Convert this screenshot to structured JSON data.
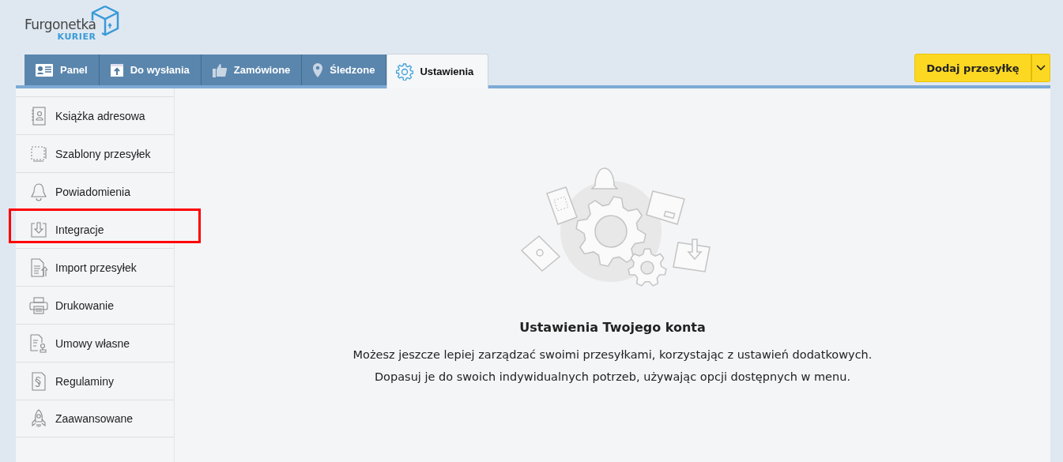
{
  "logo": {
    "name": "Furgonetka",
    "sub": "KURIER"
  },
  "tabs": [
    {
      "label": "Panel",
      "selected": false
    },
    {
      "label": "Do wysłania",
      "selected": false
    },
    {
      "label": "Zamówione",
      "selected": false
    },
    {
      "label": "Śledzone",
      "selected": false
    },
    {
      "label": "Ustawienia",
      "selected": true
    }
  ],
  "add_button": {
    "label": "Dodaj przesyłkę"
  },
  "sidebar": {
    "items": [
      {
        "label": "Książka adresowa",
        "highlighted": false
      },
      {
        "label": "Szablony przesyłek",
        "highlighted": false
      },
      {
        "label": "Powiadomienia",
        "highlighted": false
      },
      {
        "label": "Integracje",
        "highlighted": true
      },
      {
        "label": "Import przesyłek",
        "highlighted": false
      },
      {
        "label": "Drukowanie",
        "highlighted": false
      },
      {
        "label": "Umowy własne",
        "highlighted": false
      },
      {
        "label": "Regulaminy",
        "highlighted": false
      },
      {
        "label": "Zaawansowane",
        "highlighted": false
      }
    ]
  },
  "content": {
    "title": "Ustawienia Twojego konta",
    "lines": [
      "Możesz jeszcze lepiej zarządzać swoimi przesyłkami, korzystając z ustawień dodatkowych.",
      "Dopasuj je do swoich indywidualnych potrzeb, używając opcji dostępnych w menu."
    ]
  }
}
